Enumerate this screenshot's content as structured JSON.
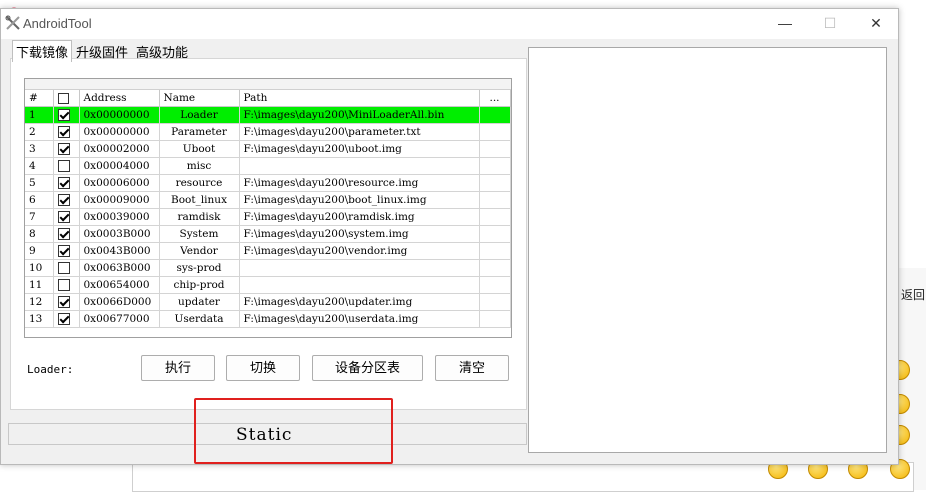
{
  "window": {
    "title": "AndroidTool"
  },
  "window_buttons": {
    "minimize": "—",
    "maximize": "☐",
    "close": "✕"
  },
  "tabs": [
    {
      "label": "下载镜像",
      "active": true
    },
    {
      "label": "升级固件",
      "active": false
    },
    {
      "label": "高级功能",
      "active": false
    }
  ],
  "grid": {
    "columns": {
      "index": "#",
      "address": "Address",
      "name": "Name",
      "path": "Path",
      "more": "..."
    },
    "rows": [
      {
        "index": "1",
        "checked": true,
        "address": "0x00000000",
        "name": "Loader",
        "path": "F:\\images\\dayu200\\MiniLoaderAll.bin",
        "selected": true
      },
      {
        "index": "2",
        "checked": true,
        "address": "0x00000000",
        "name": "Parameter",
        "path": "F:\\images\\dayu200\\parameter.txt"
      },
      {
        "index": "3",
        "checked": true,
        "address": "0x00002000",
        "name": "Uboot",
        "path": "F:\\images\\dayu200\\uboot.img"
      },
      {
        "index": "4",
        "checked": false,
        "address": "0x00004000",
        "name": "misc",
        "path": ""
      },
      {
        "index": "5",
        "checked": true,
        "address": "0x00006000",
        "name": "resource",
        "path": "F:\\images\\dayu200\\resource.img"
      },
      {
        "index": "6",
        "checked": true,
        "address": "0x00009000",
        "name": "Boot_linux",
        "path": "F:\\images\\dayu200\\boot_linux.img"
      },
      {
        "index": "7",
        "checked": true,
        "address": "0x00039000",
        "name": "ramdisk",
        "path": "F:\\images\\dayu200\\ramdisk.img"
      },
      {
        "index": "8",
        "checked": true,
        "address": "0x0003B000",
        "name": "System",
        "path": "F:\\images\\dayu200\\system.img"
      },
      {
        "index": "9",
        "checked": true,
        "address": "0x0043B000",
        "name": "Vendor",
        "path": "F:\\images\\dayu200\\vendor.img"
      },
      {
        "index": "10",
        "checked": false,
        "address": "0x0063B000",
        "name": "sys-prod",
        "path": ""
      },
      {
        "index": "11",
        "checked": false,
        "address": "0x00654000",
        "name": "chip-prod",
        "path": ""
      },
      {
        "index": "12",
        "checked": true,
        "address": "0x0066D000",
        "name": "updater",
        "path": "F:\\images\\dayu200\\updater.img"
      },
      {
        "index": "13",
        "checked": true,
        "address": "0x00677000",
        "name": "Userdata",
        "path": "F:\\images\\dayu200\\userdata.img"
      }
    ]
  },
  "actions": {
    "loader_label": "Loader:",
    "run_label": "执行",
    "switch_label": "切换",
    "partition_table_label": "设备分区表",
    "clear_label": "清空"
  },
  "status": {
    "text": "Static"
  },
  "background": {
    "right_text": "返回"
  },
  "colors": {
    "selected_row": "#00ee00",
    "highlight_box": "#e0201e"
  }
}
